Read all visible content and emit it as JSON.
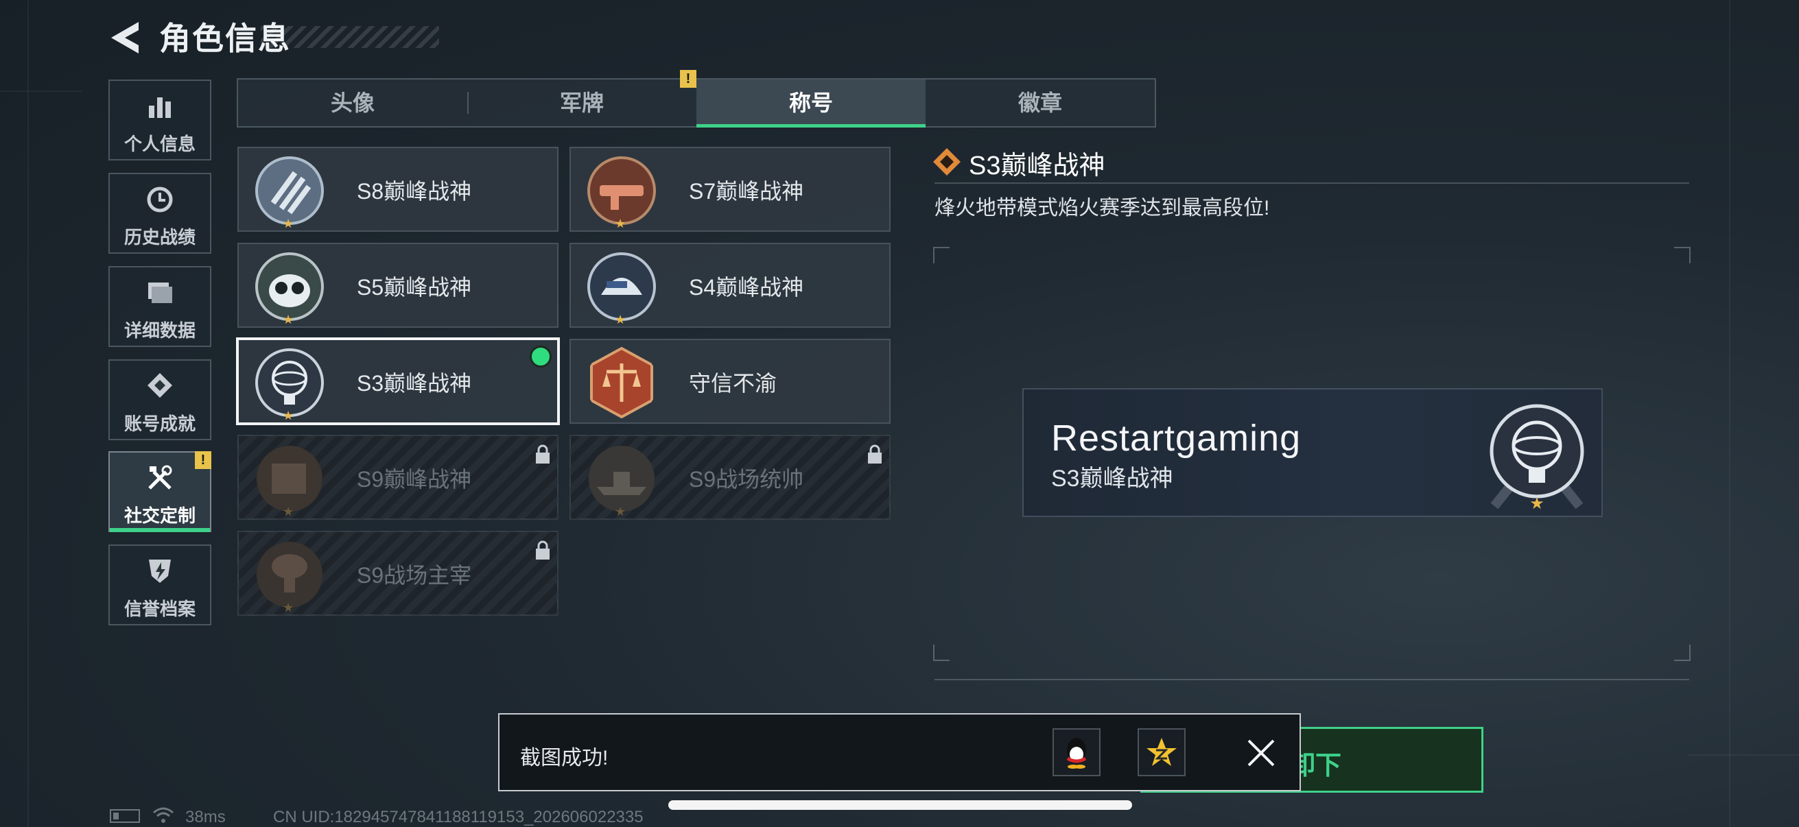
{
  "header": {
    "title": "角色信息"
  },
  "sidebar": {
    "items": [
      {
        "label": "个人信息",
        "icon": "bar-chart-icon"
      },
      {
        "label": "历史战绩",
        "icon": "history-icon"
      },
      {
        "label": "详细数据",
        "icon": "folder-icon"
      },
      {
        "label": "账号成就",
        "icon": "medal-icon"
      },
      {
        "label": "社交定制",
        "icon": "tools-icon",
        "active": true,
        "badge": "!"
      },
      {
        "label": "信誉档案",
        "icon": "shield-icon"
      }
    ]
  },
  "tabs": [
    {
      "label": "头像"
    },
    {
      "label": "军牌",
      "badge": "!"
    },
    {
      "label": "称号",
      "active": true
    },
    {
      "label": "徽章"
    }
  ],
  "titles": [
    {
      "name": "S8巅峰战神",
      "emblem": "s8-emblem-icon",
      "locked": false
    },
    {
      "name": "S7巅峰战神",
      "emblem": "s7-emblem-icon",
      "locked": false
    },
    {
      "name": "S5巅峰战神",
      "emblem": "s5-emblem-icon",
      "locked": false
    },
    {
      "name": "S4巅峰战神",
      "emblem": "s4-emblem-icon",
      "locked": false
    },
    {
      "name": "S3巅峰战神",
      "emblem": "s3-emblem-icon",
      "locked": false,
      "selected": true,
      "equipped": true
    },
    {
      "name": "守信不渝",
      "emblem": "scales-emblem-icon",
      "locked": false
    },
    {
      "name": "S9巅峰战神",
      "emblem": "s9-emblem-icon",
      "locked": true
    },
    {
      "name": "S9战场统帅",
      "emblem": "warship-emblem-icon",
      "locked": true
    },
    {
      "name": "S9战场主宰",
      "emblem": "mushroom-cloud-emblem-icon",
      "locked": true
    }
  ],
  "detail": {
    "title": "S3巅峰战神",
    "description": "烽火地带模式焰火赛季达到最高段位!",
    "preview": {
      "player_name": "Restartgaming",
      "title": "S3巅峰战神"
    }
  },
  "unload_button": {
    "label": "卸下"
  },
  "toast": {
    "message": "截图成功!"
  },
  "status_bar": {
    "ping": "38ms",
    "uid": "CN UID:182945747841188119153_202606022335"
  },
  "colors": {
    "accent": "#3ed28a",
    "warning": "#e8c24a",
    "equipped": "#2fdc7e"
  }
}
